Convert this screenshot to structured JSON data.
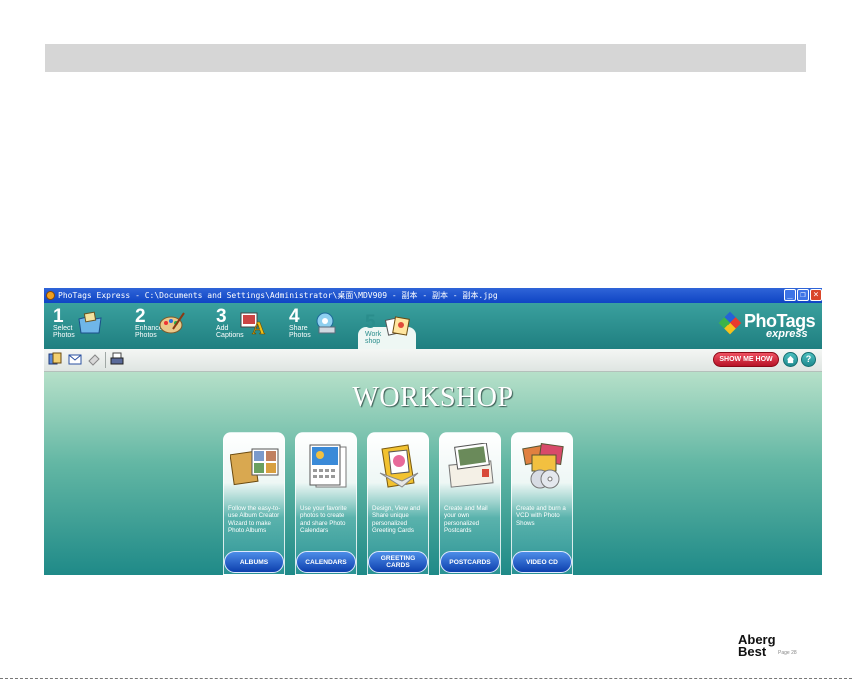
{
  "window": {
    "title": "PhoTags Express - C:\\Documents and Settings\\Administrator\\桌面\\MDV909 - 副本 - 副本 - 副本.jpg"
  },
  "steps": [
    {
      "number": "1",
      "label_line1": "Select",
      "label_line2": "Photos",
      "icon": "folder-photos-icon"
    },
    {
      "number": "2",
      "label_line1": "Enhance",
      "label_line2": "Photos",
      "icon": "palette-icon"
    },
    {
      "number": "3",
      "label_line1": "Add",
      "label_line2": "Captions",
      "icon": "caption-letter-icon"
    },
    {
      "number": "4",
      "label_line1": "Share",
      "label_line2": "Photos",
      "icon": "share-icon"
    },
    {
      "number": "5",
      "label_line1": "Work",
      "label_line2": "shop",
      "icon": "workshop-icon",
      "active": true
    }
  ],
  "logo": {
    "name": "PhoTags",
    "sub": "express"
  },
  "toolbar": {
    "show_me_how": "SHOW ME HOW",
    "home_icon": "home-icon",
    "help_label": "?"
  },
  "workshop": {
    "heading": "WORKSHOP",
    "cards": [
      {
        "desc": "Follow the easy-to-use Album Creator Wizard to make Photo Albums",
        "button": "ALBUMS"
      },
      {
        "desc": "Use your favorite photos to create and share Photo Calendars",
        "button": "CALENDARS"
      },
      {
        "desc": "Design, View and Share unique personalized Greeting Cards",
        "button": "GREETING CARDS"
      },
      {
        "desc": "Create and Mail your own personalized Postcards",
        "button": "POSTCARDS"
      },
      {
        "desc": "Create and burn a VCD with Photo Shows",
        "button": "VIDEO CD"
      }
    ]
  },
  "brand": {
    "line1": "Aberg",
    "line2": "Best",
    "page": "Page 28"
  }
}
